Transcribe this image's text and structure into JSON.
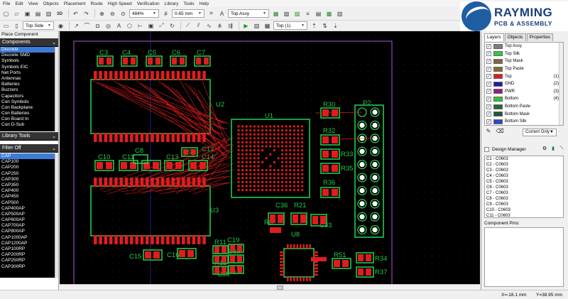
{
  "menu": [
    "File",
    "Edit",
    "View",
    "Objects",
    "Placement",
    "Route",
    "High Speed",
    "Verification",
    "Library",
    "Tools",
    "Help"
  ],
  "toolbar": {
    "view_3d_label": "3D",
    "zoom_value": "484%",
    "grid_value": "0.65 mm",
    "layer_set_value": "Top Assy",
    "side_value": "Top Side",
    "layer_value": "Top (1)"
  },
  "logo": {
    "title": "RAYMING",
    "subtitle": "PCB & ASSEMBLY"
  },
  "left_panel": {
    "title": "Place Component",
    "components_header": "Components",
    "components": [
      "Discrete",
      "Discrete SMD",
      "Symbols",
      "Symbols EIC",
      "Net Ports",
      "Antennas",
      "Batteries",
      "Buzzers",
      "Capacitors",
      "Con Symbols",
      "Con Backplane",
      "Con Batteries",
      "Con Board In",
      "Con D-Sub"
    ],
    "library_tools_label": "Library Tools",
    "filter_label": "Filter Off",
    "parts": [
      "CAP",
      "CAP100",
      "CAP200",
      "CAP250",
      "CAP300",
      "CAP350",
      "CAP400",
      "CAP450",
      "CAP500",
      "CAP400AP",
      "CAP500AP",
      "CAP600AP",
      "CAP700AP",
      "CAP800AP",
      "CAP1000AP",
      "CAP1200AP",
      "CAP100RP",
      "CAP200RP",
      "CAP250RP",
      "CAP300RP"
    ]
  },
  "canvas": {
    "colors": {
      "background": "#000000",
      "copper": "#e01d1d",
      "silk": "#22c84a",
      "outline": "#b054d8",
      "pad_white": "#ffffff"
    },
    "labels": [
      "C3",
      "C4",
      "C5",
      "C6",
      "C7",
      "U2",
      "U1",
      "P2",
      "R30",
      "R32",
      "R33",
      "R35",
      "R36",
      "C10",
      "C11",
      "C8",
      "C9",
      "C13",
      "C14",
      "C12",
      "U3",
      "C36",
      "R21",
      "C33",
      "R8",
      "U8",
      "R11",
      "C19",
      "C35",
      "R12",
      "R9",
      "C18",
      "C15",
      "C16",
      "R51",
      "R34",
      "R37"
    ]
  },
  "right_panel": {
    "tabs": [
      "Layers",
      "Objects",
      "Properties"
    ],
    "layers": [
      {
        "name": "Top Assy",
        "num": "",
        "color": "#7d7d7d"
      },
      {
        "name": "Top Silk",
        "num": "",
        "color": "#2ecc40"
      },
      {
        "name": "Top Mask",
        "num": "",
        "color": "#7b6a3a"
      },
      {
        "name": "Top Paste",
        "num": "",
        "color": "#8a6d2a"
      },
      {
        "name": "Top",
        "num": "(1)",
        "color": "#e01d1d"
      },
      {
        "name": "GND",
        "num": "(2)",
        "color": "#1e1ea8"
      },
      {
        "name": "PWR",
        "num": "(3)",
        "color": "#9a1a8a"
      },
      {
        "name": "Bottom",
        "num": "(4)",
        "color": "#2dc833"
      },
      {
        "name": "Bottom Paste",
        "num": "",
        "color": "#1e6b33"
      },
      {
        "name": "Bottom Mask",
        "num": "",
        "color": "#1a5a3a"
      },
      {
        "name": "Bottom Silk",
        "num": "",
        "color": "#2a49c8"
      }
    ],
    "current_only_label": "Current Only",
    "design_manager_label": "Design Manager",
    "design_items": [
      "C1 - C0603",
      "C2 - C0603",
      "C3 - C0603",
      "C4 - C0603",
      "C5 - C0603",
      "C6 - C0603",
      "C7 - C0603",
      "C8 - C0603",
      "C9 - C0603",
      "C10 - C0603",
      "C11 - C0603",
      "C12 - C0603"
    ],
    "component_pins_label": "Component Pins:"
  },
  "status": {
    "x": "X=-18.1 mm",
    "y": "Y=38.95 mm"
  }
}
